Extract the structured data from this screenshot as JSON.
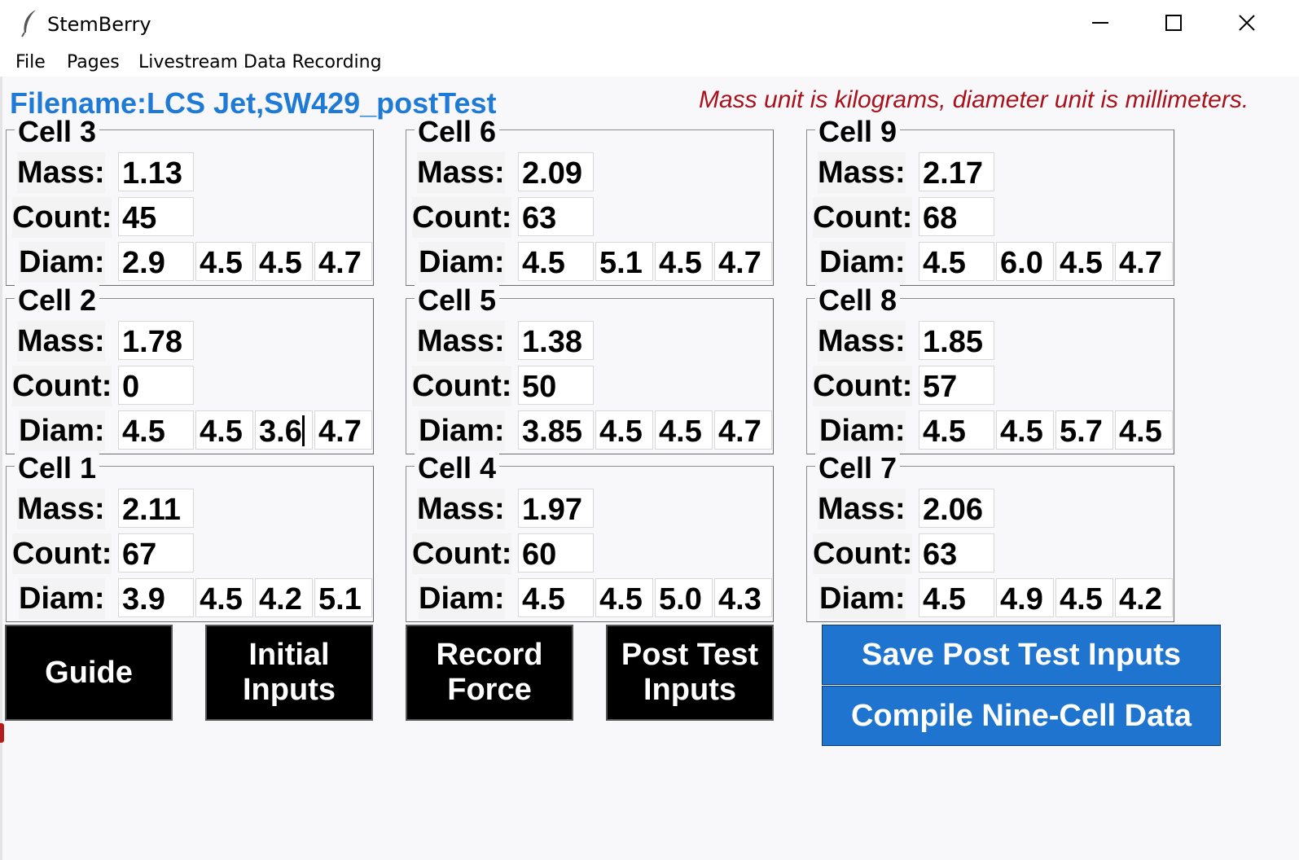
{
  "window": {
    "title": "StemBerry",
    "minimize_icon": "minimize-icon",
    "maximize_icon": "maximize-icon",
    "close_icon": "close-icon"
  },
  "menu": [
    "File",
    "Pages",
    "Livestream Data Recording"
  ],
  "header": {
    "filename": "Filename:LCS Jet,SW429_postTest",
    "unit_note": "Mass unit is kilograms, diameter unit is millimeters."
  },
  "labels": {
    "mass": "Mass:",
    "count": "Count:",
    "diam": "Diam:"
  },
  "cells": [
    {
      "title": "Cell 3",
      "mass": "1.13",
      "count": "45",
      "diam": [
        "2.9",
        "4.5",
        "4.5",
        "4.7"
      ]
    },
    {
      "title": "Cell 6",
      "mass": "2.09",
      "count": "63",
      "diam": [
        "4.5",
        "5.1",
        "4.5",
        "4.7"
      ]
    },
    {
      "title": "Cell 9",
      "mass": "2.17",
      "count": "68",
      "diam": [
        "4.5",
        "6.0",
        "4.5",
        "4.7"
      ]
    },
    {
      "title": "Cell 2",
      "mass": "1.78",
      "count": "0",
      "diam": [
        "4.5",
        "4.5",
        "3.6",
        "4.7"
      ]
    },
    {
      "title": "Cell 5",
      "mass": "1.38",
      "count": "50",
      "diam": [
        "3.85",
        "4.5",
        "4.5",
        "4.7"
      ]
    },
    {
      "title": "Cell 8",
      "mass": "1.85",
      "count": "57",
      "diam": [
        "4.5",
        "4.5",
        "5.7",
        "4.5"
      ]
    },
    {
      "title": "Cell 1",
      "mass": "2.11",
      "count": "67",
      "diam": [
        "3.9",
        "4.5",
        "4.2",
        "5.1"
      ]
    },
    {
      "title": "Cell 4",
      "mass": "1.97",
      "count": "60",
      "diam": [
        "4.5",
        "4.5",
        "5.0",
        "4.3"
      ]
    },
    {
      "title": "Cell 7",
      "mass": "2.06",
      "count": "63",
      "diam": [
        "4.5",
        "4.9",
        "4.5",
        "4.2"
      ]
    }
  ],
  "buttons": {
    "guide": "Guide",
    "initial_inputs": "Initial Inputs",
    "record_force": "Record Force",
    "post_test_inputs": "Post Test Inputs",
    "save_post_test": "Save Post Test Inputs",
    "compile": "Compile Nine-Cell Data"
  },
  "colors": {
    "filename": "#1f7ad6",
    "unit_note": "#a8121b",
    "black_button": "#000000",
    "blue_button": "#1e74ce"
  }
}
